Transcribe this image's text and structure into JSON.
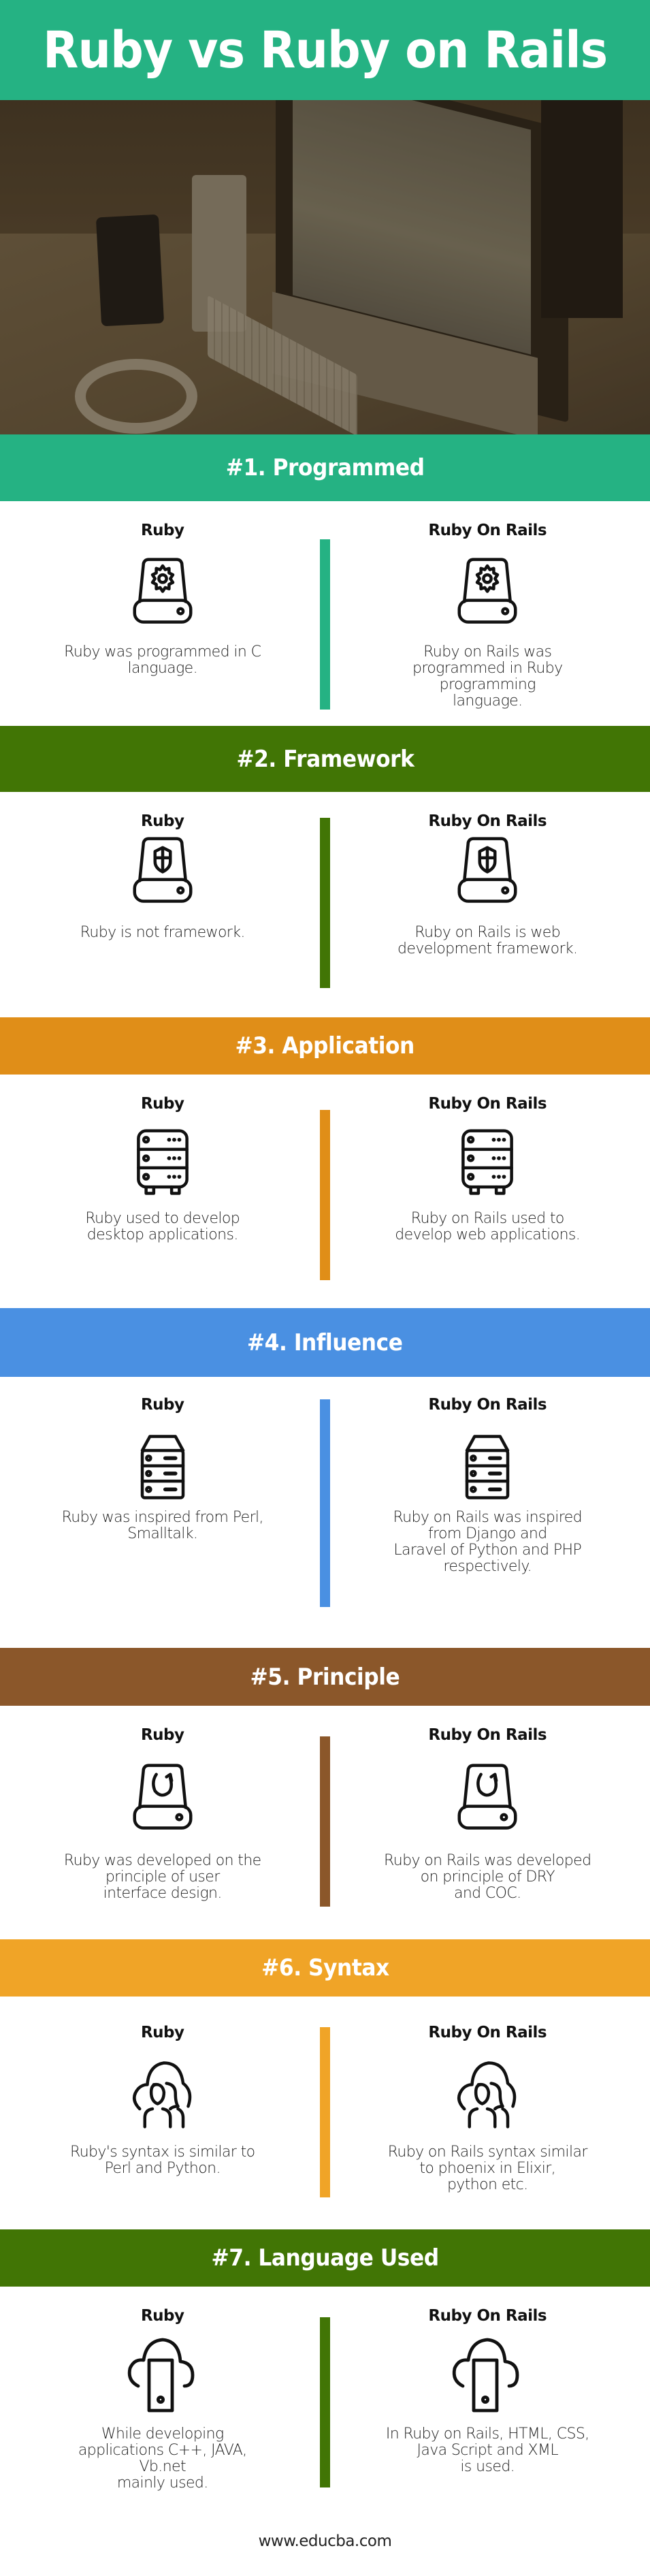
{
  "title": "Ruby vs Ruby on Rails",
  "colors": {
    "title_band": "#25b283",
    "section_1": "#25b283",
    "section_2": "#417505",
    "section_3": "#e08e18",
    "section_4": "#4a90e2",
    "section_5": "#8b572a",
    "section_6": "#f0a427",
    "section_7": "#417505"
  },
  "hero_image": {
    "description": "desk with iMac, keyboard, headphones and phone"
  },
  "sections": [
    {
      "heading": "#1. Programmed",
      "icon": "drive-gear-icon",
      "left": {
        "title": "Ruby",
        "text": "Ruby was programmed in C\nlanguage."
      },
      "right": {
        "title": "Ruby On Rails",
        "text": "Ruby on Rails was\nprogrammed in Ruby\nprogramming\nlanguage."
      }
    },
    {
      "heading": "#2. Framework",
      "icon": "drive-shield-icon",
      "left": {
        "title": "Ruby",
        "text": "Ruby is not framework."
      },
      "right": {
        "title": "Ruby On Rails",
        "text": "Ruby on Rails is web\ndevelopment framework."
      }
    },
    {
      "heading": "#3. Application",
      "icon": "server-rack-icon",
      "left": {
        "title": "Ruby",
        "text": "Ruby used to develop\ndesktop applications."
      },
      "right": {
        "title": "Ruby On Rails",
        "text": "Ruby on Rails used to\ndevelop web applications."
      }
    },
    {
      "heading": "#4. Influence",
      "icon": "server-stack-icon",
      "left": {
        "title": "Ruby",
        "text": "Ruby was inspired from Perl,\nSmalltalk."
      },
      "right": {
        "title": "Ruby On Rails",
        "text": "Ruby on Rails was inspired\nfrom Django and\nLaravel of Python and PHP\nrespectively."
      }
    },
    {
      "heading": "#5. Principle",
      "icon": "drive-refresh-icon",
      "left": {
        "title": "Ruby",
        "text": "Ruby was developed on the\nprinciple of user\ninterface design."
      },
      "right": {
        "title": "Ruby On Rails",
        "text": "Ruby on Rails was developed\non principle of DRY\nand COC."
      }
    },
    {
      "heading": "#6. Syntax",
      "icon": "cloud-users-icon",
      "left": {
        "title": "Ruby",
        "text": "Ruby's syntax is similar to\nPerl and Python."
      },
      "right": {
        "title": "Ruby On Rails",
        "text": "Ruby on Rails syntax similar\nto phoenix in Elixir,\npython etc."
      }
    },
    {
      "heading": "#7. Language Used",
      "icon": "cloud-mobile-icon",
      "left": {
        "title": "Ruby",
        "text": "While developing\napplications C++, JAVA,\nVb.net\nmainly used."
      },
      "right": {
        "title": "Ruby On Rails",
        "text": "In Ruby on Rails, HTML, CSS,\nJava Script and XML\nis used."
      }
    }
  ],
  "footer": {
    "website": "www.educba.com"
  }
}
